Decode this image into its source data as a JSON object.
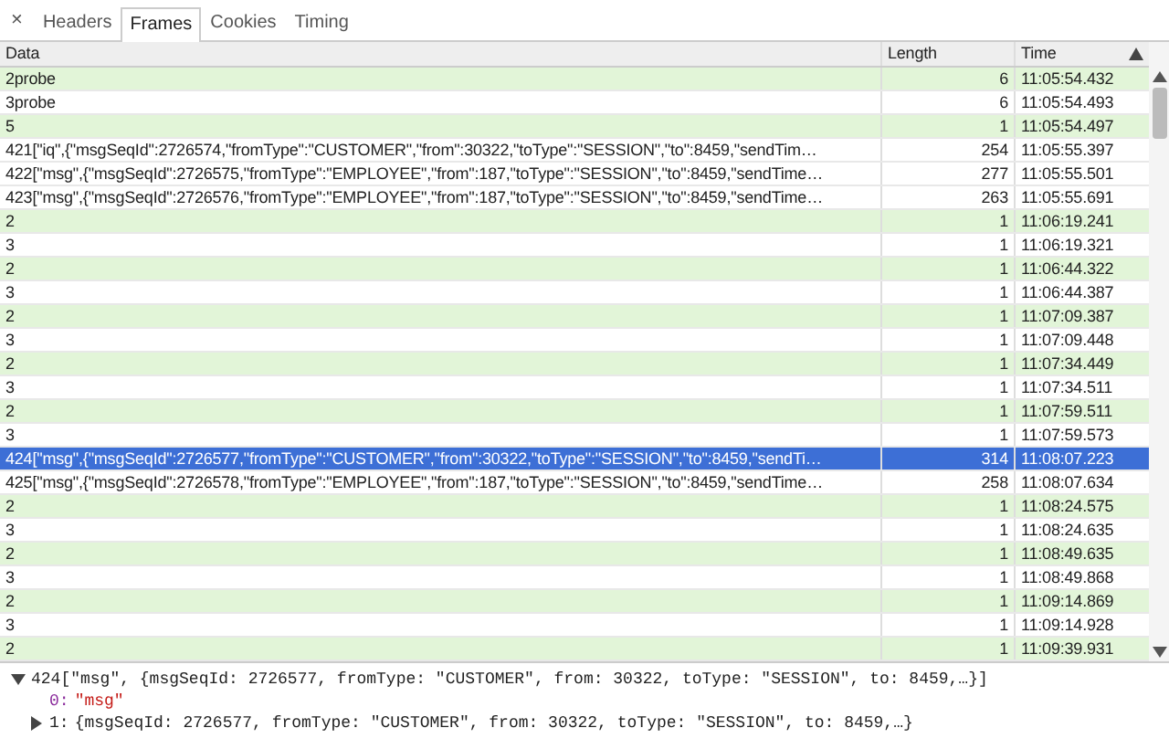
{
  "close_glyph": "×",
  "tabs": [
    {
      "label": "Headers",
      "selected": false
    },
    {
      "label": "Frames",
      "selected": true
    },
    {
      "label": "Cookies",
      "selected": false
    },
    {
      "label": "Timing",
      "selected": false
    }
  ],
  "table": {
    "columns": [
      "Data",
      "Length",
      "Time"
    ],
    "rows": [
      {
        "data": "2probe",
        "length": "6",
        "time": "11:05:54.432",
        "kind": "sent",
        "selected": false
      },
      {
        "data": "3probe",
        "length": "6",
        "time": "11:05:54.493",
        "kind": "received",
        "selected": false
      },
      {
        "data": "5",
        "length": "1",
        "time": "11:05:54.497",
        "kind": "sent",
        "selected": false
      },
      {
        "data": "421[\"iq\",{\"msgSeqId\":2726574,\"fromType\":\"CUSTOMER\",\"from\":30322,\"toType\":\"SESSION\",\"to\":8459,\"sendTim…",
        "length": "254",
        "time": "11:05:55.397",
        "kind": "received",
        "selected": false
      },
      {
        "data": "422[\"msg\",{\"msgSeqId\":2726575,\"fromType\":\"EMPLOYEE\",\"from\":187,\"toType\":\"SESSION\",\"to\":8459,\"sendTime…",
        "length": "277",
        "time": "11:05:55.501",
        "kind": "received",
        "selected": false
      },
      {
        "data": "423[\"msg\",{\"msgSeqId\":2726576,\"fromType\":\"EMPLOYEE\",\"from\":187,\"toType\":\"SESSION\",\"to\":8459,\"sendTime…",
        "length": "263",
        "time": "11:05:55.691",
        "kind": "received",
        "selected": false
      },
      {
        "data": "2",
        "length": "1",
        "time": "11:06:19.241",
        "kind": "sent",
        "selected": false
      },
      {
        "data": "3",
        "length": "1",
        "time": "11:06:19.321",
        "kind": "received",
        "selected": false
      },
      {
        "data": "2",
        "length": "1",
        "time": "11:06:44.322",
        "kind": "sent",
        "selected": false
      },
      {
        "data": "3",
        "length": "1",
        "time": "11:06:44.387",
        "kind": "received",
        "selected": false
      },
      {
        "data": "2",
        "length": "1",
        "time": "11:07:09.387",
        "kind": "sent",
        "selected": false
      },
      {
        "data": "3",
        "length": "1",
        "time": "11:07:09.448",
        "kind": "received",
        "selected": false
      },
      {
        "data": "2",
        "length": "1",
        "time": "11:07:34.449",
        "kind": "sent",
        "selected": false
      },
      {
        "data": "3",
        "length": "1",
        "time": "11:07:34.511",
        "kind": "received",
        "selected": false
      },
      {
        "data": "2",
        "length": "1",
        "time": "11:07:59.511",
        "kind": "sent",
        "selected": false
      },
      {
        "data": "3",
        "length": "1",
        "time": "11:07:59.573",
        "kind": "received",
        "selected": false
      },
      {
        "data": "424[\"msg\",{\"msgSeqId\":2726577,\"fromType\":\"CUSTOMER\",\"from\":30322,\"toType\":\"SESSION\",\"to\":8459,\"sendTi…",
        "length": "314",
        "time": "11:08:07.223",
        "kind": "received",
        "selected": true
      },
      {
        "data": "425[\"msg\",{\"msgSeqId\":2726578,\"fromType\":\"EMPLOYEE\",\"from\":187,\"toType\":\"SESSION\",\"to\":8459,\"sendTime…",
        "length": "258",
        "time": "11:08:07.634",
        "kind": "received",
        "selected": false
      },
      {
        "data": "2",
        "length": "1",
        "time": "11:08:24.575",
        "kind": "sent",
        "selected": false
      },
      {
        "data": "3",
        "length": "1",
        "time": "11:08:24.635",
        "kind": "received",
        "selected": false
      },
      {
        "data": "2",
        "length": "1",
        "time": "11:08:49.635",
        "kind": "sent",
        "selected": false
      },
      {
        "data": "3",
        "length": "1",
        "time": "11:08:49.868",
        "kind": "received",
        "selected": false
      },
      {
        "data": "2",
        "length": "1",
        "time": "11:09:14.869",
        "kind": "sent",
        "selected": false
      },
      {
        "data": "3",
        "length": "1",
        "time": "11:09:14.928",
        "kind": "received",
        "selected": false
      },
      {
        "data": "2",
        "length": "1",
        "time": "11:09:39.931",
        "kind": "sent",
        "selected": false
      }
    ]
  },
  "details": [
    {
      "text": "424[\"msg\", {msgSeqId: 2726577, fromType: \"CUSTOMER\", from: 30322, toType: \"SESSION\", to: 8459,…}]",
      "expanded": true,
      "children": [
        {
          "key": "0:",
          "value": "\"msg\"",
          "kind": "string"
        },
        {
          "key": "1:",
          "value": "{msgSeqId: 2726577, fromType: \"CUSTOMER\", from: 30322, toType: \"SESSION\", to: 8459,…}",
          "kind": "object",
          "expanded": false
        }
      ]
    }
  ]
}
